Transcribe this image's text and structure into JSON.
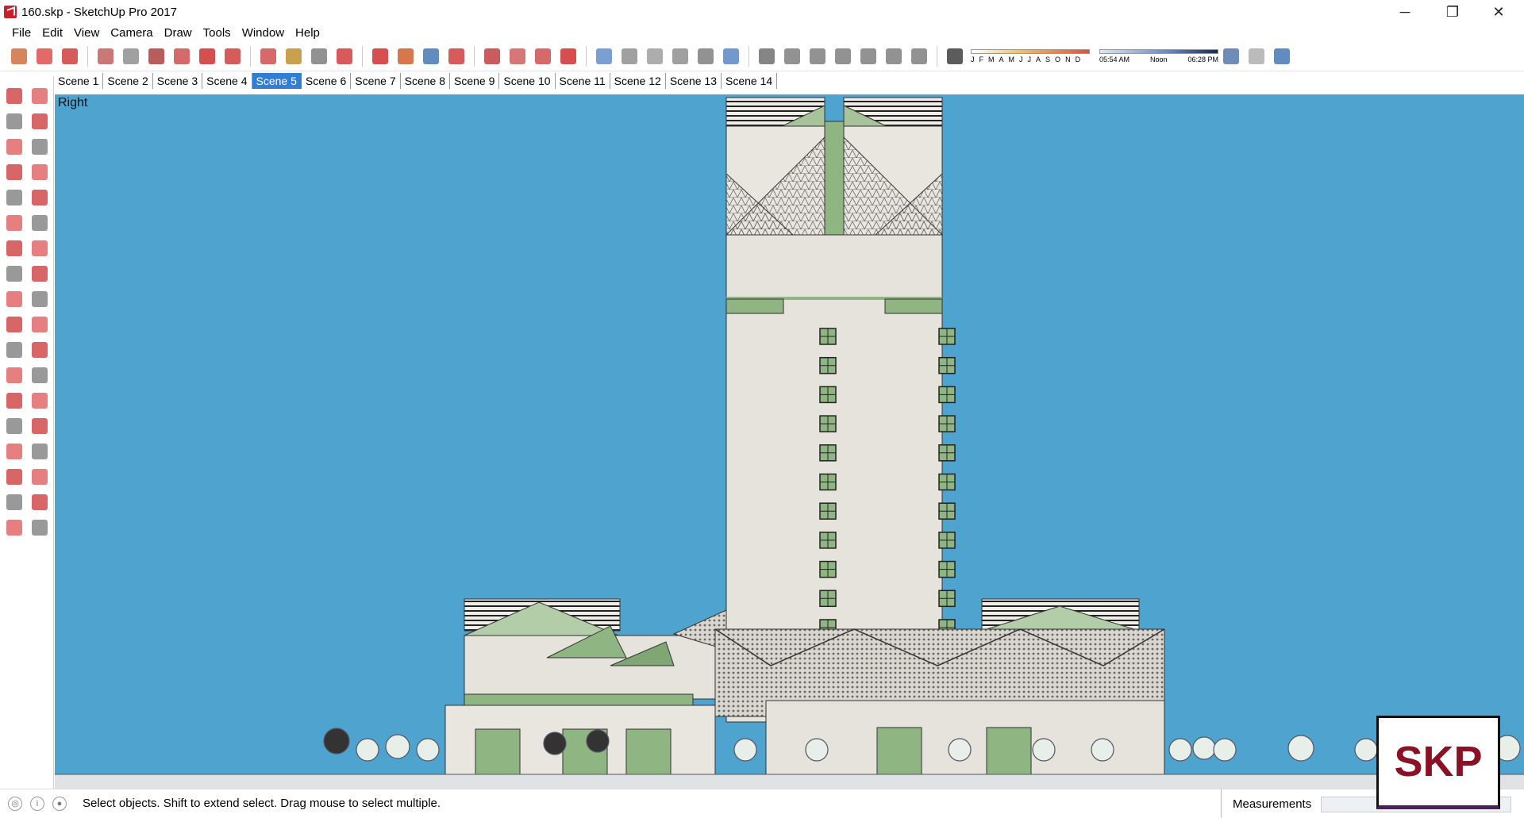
{
  "window": {
    "title": "160.skp - SketchUp Pro 2017",
    "controls": {
      "minimize": "─",
      "restore": "❐",
      "close": "✕"
    }
  },
  "menu": [
    "File",
    "Edit",
    "View",
    "Camera",
    "Draw",
    "Tools",
    "Window",
    "Help"
  ],
  "toolbar": {
    "icons": [
      "select-icon",
      "eraser-icon",
      "line-icon",
      "arc-icon",
      "shape-icon",
      "push-pull-icon",
      "follow-me-icon",
      "move-icon",
      "rotate-icon",
      "scale-icon",
      "tape-measure-icon",
      "text-icon",
      "paint-bucket-icon",
      "orbit-icon",
      "pan-icon",
      "zoom-icon",
      "zoom-extents-icon",
      "3d-warehouse-icon",
      "extension-warehouse-icon",
      "layout-icon",
      "ruby-icon",
      "xray-icon",
      "back-edges-icon",
      "wireframe-icon",
      "hidden-line-icon",
      "shaded-icon",
      "textured-icon",
      "monochrome-icon",
      "iso-view-icon",
      "top-view-icon",
      "front-view-icon",
      "right-view-icon",
      "back-view-icon",
      "left-view-icon",
      "shadows-toggle-icon",
      "geo-location-icon",
      "share-model-icon",
      "get-models-icon"
    ],
    "shadow_months": [
      "J",
      "F",
      "M",
      "A",
      "M",
      "J",
      "J",
      "A",
      "S",
      "O",
      "N",
      "D"
    ],
    "shadow_times": [
      "05:54 AM",
      "Noon",
      "06:28 PM"
    ]
  },
  "scenes": [
    "Scene 1",
    "Scene 2",
    "Scene 3",
    "Scene 4",
    "Scene 5",
    "Scene 6",
    "Scene 7",
    "Scene 8",
    "Scene 9",
    "Scene 10",
    "Scene 11",
    "Scene 12",
    "Scene 13",
    "Scene 14"
  ],
  "active_scene": "Scene 5",
  "viewport": {
    "label": "Right"
  },
  "status": {
    "hint": "Select objects. Shift to extend select. Drag mouse to select multiple.",
    "measurements_label": "Measurements",
    "info_icons": [
      "geo-location-status-icon",
      "credits-icon",
      "user-account-icon"
    ]
  },
  "logo": {
    "text": "SKP"
  },
  "colors": {
    "sky": "#4ea3cf",
    "accent": "#2f7ed8",
    "glass": "#8fb583",
    "facade": "#e6e2dc"
  }
}
